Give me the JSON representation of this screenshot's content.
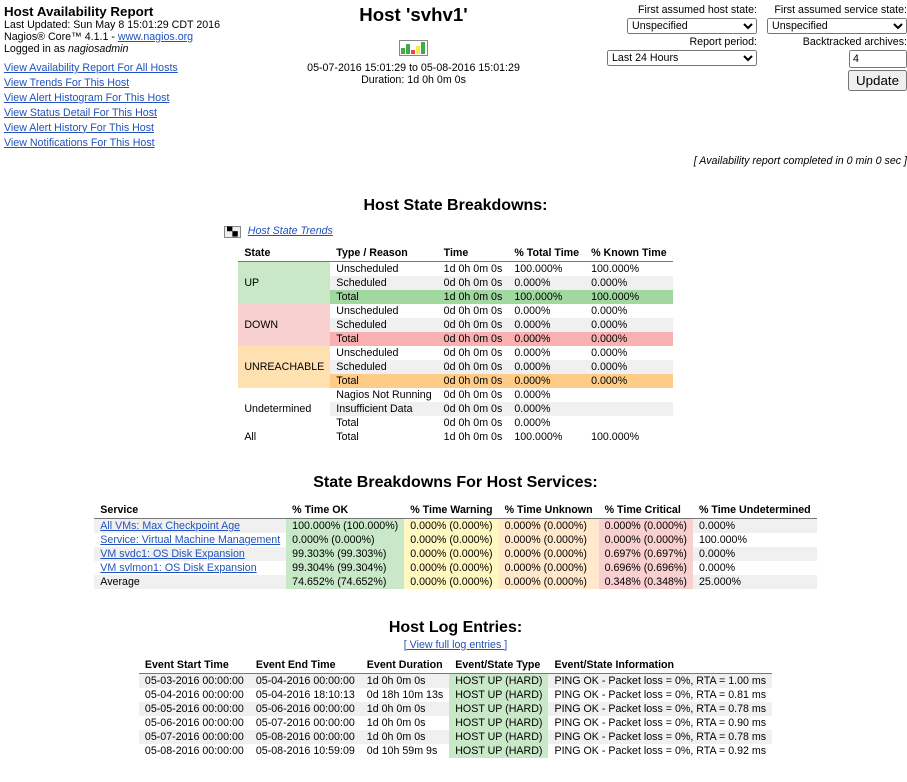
{
  "header": {
    "info_title": "Host Availability Report",
    "last_updated": "Last Updated: Sun May 8 15:01:29 CDT 2016",
    "product": "Nagios® Core™ 4.1.1 - ",
    "product_link": "www.nagios.org",
    "logged_in_prefix": "Logged in as ",
    "logged_in_user": "nagiosadmin",
    "nav": [
      "View Availability Report For All Hosts",
      "View Trends For This Host",
      "View Alert Histogram For This Host",
      "View Status Detail For This Host",
      "View Alert History For This Host",
      "View Notifications For This Host"
    ],
    "center_title_prefix": "Host '",
    "center_title_host": "svhv1",
    "center_title_suffix": "'",
    "range": "05-07-2016 15:01:29 to 05-08-2016 15:01:29",
    "duration": "Duration: 1d 0h 0m 0s",
    "options": {
      "labels": {
        "host_state": "First assumed host state:",
        "svc_state": "First assumed service state:",
        "report_period": "Report period:",
        "backtracked": "Backtracked archives:",
        "update": "Update"
      },
      "values": {
        "host_state": "Unspecified",
        "svc_state": "Unspecified",
        "report_period": "Last 24 Hours",
        "backtracked": "4"
      }
    },
    "footer_note": "[ Availability report completed in 0 min 0 sec ]"
  },
  "state_breakdowns": {
    "title": "Host State Breakdowns:",
    "trends_link": "Host State Trends",
    "cols": [
      "State",
      "Type / Reason",
      "Time",
      "% Total Time",
      "% Known Time"
    ],
    "groups": [
      {
        "name": "UP",
        "cls": "up",
        "rows": [
          [
            "Unscheduled",
            "1d 0h 0m 0s",
            "100.000%",
            "100.000%"
          ],
          [
            "Scheduled",
            "0d 0h 0m 0s",
            "0.000%",
            "0.000%"
          ],
          [
            "Total",
            "1d 0h 0m 0s",
            "100.000%",
            "100.000%"
          ]
        ]
      },
      {
        "name": "DOWN",
        "cls": "down",
        "rows": [
          [
            "Unscheduled",
            "0d 0h 0m 0s",
            "0.000%",
            "0.000%"
          ],
          [
            "Scheduled",
            "0d 0h 0m 0s",
            "0.000%",
            "0.000%"
          ],
          [
            "Total",
            "0d 0h 0m 0s",
            "0.000%",
            "0.000%"
          ]
        ]
      },
      {
        "name": "UNREACHABLE",
        "cls": "unr",
        "rows": [
          [
            "Unscheduled",
            "0d 0h 0m 0s",
            "0.000%",
            "0.000%"
          ],
          [
            "Scheduled",
            "0d 0h 0m 0s",
            "0.000%",
            "0.000%"
          ],
          [
            "Total",
            "0d 0h 0m 0s",
            "0.000%",
            "0.000%"
          ]
        ]
      },
      {
        "name": "Undetermined",
        "cls": "undet",
        "rows": [
          [
            "Nagios Not Running",
            "0d 0h 0m 0s",
            "0.000%",
            ""
          ],
          [
            "Insufficient Data",
            "0d 0h 0m 0s",
            "0.000%",
            ""
          ],
          [
            "Total",
            "0d 0h 0m 0s",
            "0.000%",
            ""
          ]
        ]
      },
      {
        "name": "All",
        "cls": "all",
        "rows": [
          [
            "Total",
            "1d 0h 0m 0s",
            "100.000%",
            "100.000%"
          ]
        ]
      }
    ]
  },
  "svc_breakdowns": {
    "title": "State Breakdowns For Host Services:",
    "cols": [
      "Service",
      "% Time OK",
      "% Time Warning",
      "% Time Unknown",
      "% Time Critical",
      "% Time Undetermined"
    ],
    "rows": [
      {
        "svc": "All VMs: Max Checkpoint Age",
        "link": true,
        "ok": "100.000% (100.000%)",
        "warn": "0.000% (0.000%)",
        "unk": "0.000% (0.000%)",
        "crit": "0.000% (0.000%)",
        "und": "0.000%"
      },
      {
        "svc": "Service: Virtual Machine Management",
        "link": true,
        "ok": "0.000% (0.000%)",
        "warn": "0.000% (0.000%)",
        "unk": "0.000% (0.000%)",
        "crit": "0.000% (0.000%)",
        "und": "100.000%"
      },
      {
        "svc": "VM svdc1: OS Disk Expansion",
        "link": true,
        "ok": "99.303% (99.303%)",
        "warn": "0.000% (0.000%)",
        "unk": "0.000% (0.000%)",
        "crit": "0.697% (0.697%)",
        "und": "0.000%"
      },
      {
        "svc": "VM svlmon1: OS Disk Expansion",
        "link": true,
        "ok": "99.304% (99.304%)",
        "warn": "0.000% (0.000%)",
        "unk": "0.000% (0.000%)",
        "crit": "0.696% (0.696%)",
        "und": "0.000%"
      },
      {
        "svc": "Average",
        "link": false,
        "ok": "74.652% (74.652%)",
        "warn": "0.000% (0.000%)",
        "unk": "0.000% (0.000%)",
        "crit": "0.348% (0.348%)",
        "und": "25.000%"
      }
    ]
  },
  "log_entries": {
    "title": "Host Log Entries:",
    "full_link": "[ View full log entries ]",
    "cols": [
      "Event Start Time",
      "Event End Time",
      "Event Duration",
      "Event/State Type",
      "Event/State Information"
    ],
    "rows": [
      [
        "05-03-2016 00:00:00",
        "05-04-2016 00:00:00",
        "1d 0h 0m 0s",
        "HOST UP (HARD)",
        "PING OK - Packet loss = 0%, RTA = 1.00 ms"
      ],
      [
        "05-04-2016 00:00:00",
        "05-04-2016 18:10:13",
        "0d 18h 10m 13s",
        "HOST UP (HARD)",
        "PING OK - Packet loss = 0%, RTA = 0.81 ms"
      ],
      [
        "05-05-2016 00:00:00",
        "05-06-2016 00:00:00",
        "1d 0h 0m 0s",
        "HOST UP (HARD)",
        "PING OK - Packet loss = 0%, RTA = 0.78 ms"
      ],
      [
        "05-06-2016 00:00:00",
        "05-07-2016 00:00:00",
        "1d 0h 0m 0s",
        "HOST UP (HARD)",
        "PING OK - Packet loss = 0%, RTA = 0.90 ms"
      ],
      [
        "05-07-2016 00:00:00",
        "05-08-2016 00:00:00",
        "1d 0h 0m 0s",
        "HOST UP (HARD)",
        "PING OK - Packet loss = 0%, RTA = 0.78 ms"
      ],
      [
        "05-08-2016 00:00:00",
        "05-08-2016 10:59:09",
        "0d 10h 59m 9s",
        "HOST UP (HARD)",
        "PING OK - Packet loss = 0%, RTA = 0.92 ms"
      ]
    ]
  }
}
